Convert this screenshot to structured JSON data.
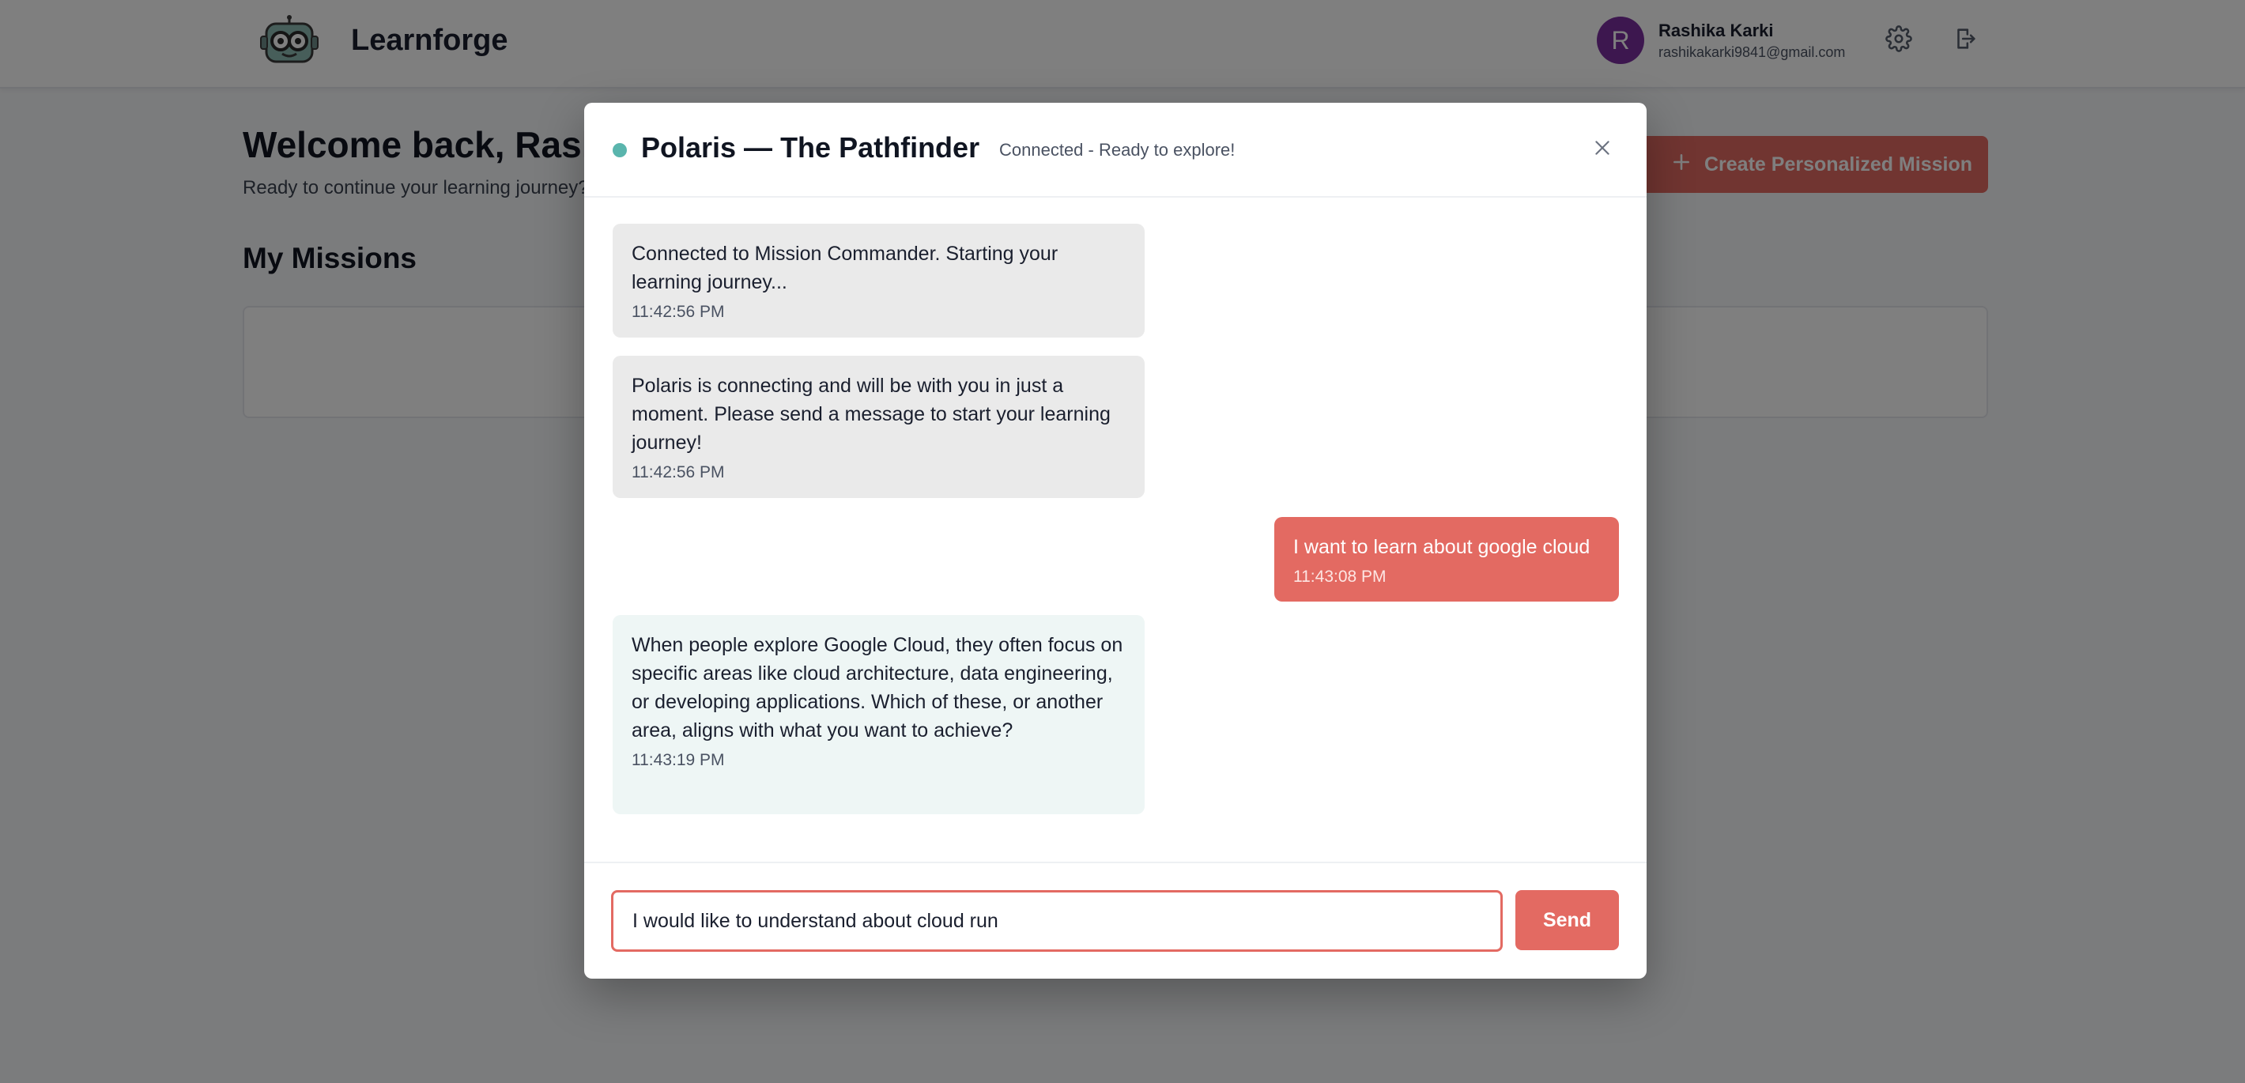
{
  "app": {
    "brand": "Learnforge",
    "logo_icon": "robot-mascot-icon"
  },
  "user": {
    "initial": "R",
    "name": "Rashika Karki",
    "email": "rashikakarki9841@gmail.com",
    "avatar_color": "#7b2f9e"
  },
  "header_icons": {
    "settings": "gear-icon",
    "logout": "logout-icon"
  },
  "dashboard": {
    "welcome": "Welcome back, Rashika!",
    "subtitle": "Ready to continue your learning journey?",
    "create_button_label": "Create Personalized Mission",
    "missions_title": "My Missions"
  },
  "modal": {
    "title": "Polaris — The Pathfinder",
    "status": "Connected - Ready to explore!",
    "status_color": "#5ab5ad",
    "messages": [
      {
        "role": "system",
        "text": "Connected to Mission Commander. Starting your learning journey...",
        "time": "11:42:56 PM"
      },
      {
        "role": "system",
        "text": "Polaris is connecting and will be with you in just a moment. Please send a message to start your learning journey!",
        "time": "11:42:56 PM"
      },
      {
        "role": "user",
        "text": "I want to learn about google cloud",
        "time": "11:43:08 PM"
      },
      {
        "role": "bot",
        "text": "When people explore Google Cloud, they often focus on specific areas like cloud architecture, data engineering, or developing applications. Which of these, or another area, aligns with what you want to achieve?",
        "time": "11:43:19 PM"
      }
    ],
    "input_value": "I would like to understand about cloud run",
    "send_label": "Send"
  },
  "colors": {
    "accent": "#e36a62",
    "system_bubble": "#eaeaea",
    "bot_bubble": "#eef6f5"
  }
}
